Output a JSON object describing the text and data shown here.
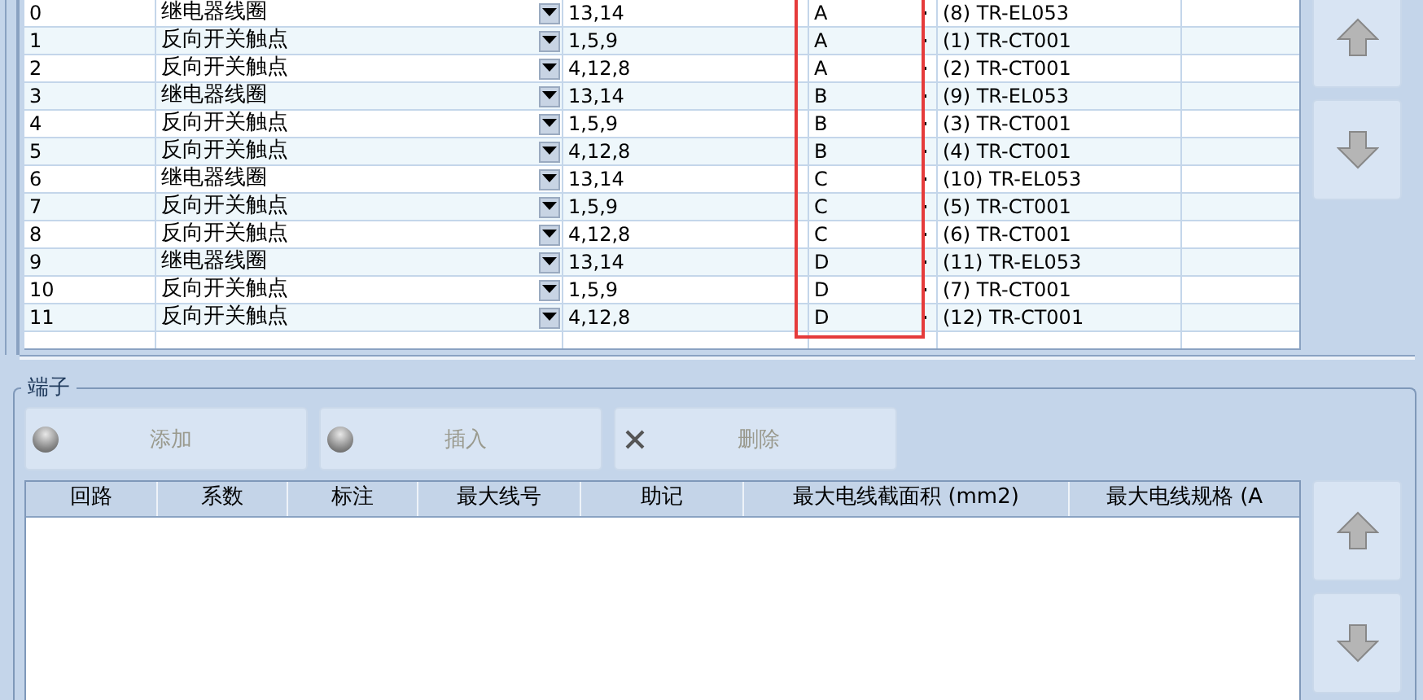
{
  "top_grid": {
    "rows": [
      {
        "column_1": "0",
        "column_2": "继电器线圈",
        "column_3": "13,14",
        "column_4": "A",
        "column_5": "(8) TR-EL053"
      },
      {
        "column_1": "1",
        "column_2": "反向开关触点",
        "column_3": "1,5,9",
        "column_4": "A",
        "column_5": "(1) TR-CT001"
      },
      {
        "column_1": "2",
        "column_2": "反向开关触点",
        "column_3": "4,12,8",
        "column_4": "A",
        "column_5": "(2) TR-CT001"
      },
      {
        "column_1": "3",
        "column_2": "继电器线圈",
        "column_3": "13,14",
        "column_4": "B",
        "column_5": "(9) TR-EL053"
      },
      {
        "column_1": "4",
        "column_2": "反向开关触点",
        "column_3": "1,5,9",
        "column_4": "B",
        "column_5": "(3) TR-CT001"
      },
      {
        "column_1": "5",
        "column_2": "反向开关触点",
        "column_3": "4,12,8",
        "column_4": "B",
        "column_5": "(4) TR-CT001"
      },
      {
        "column_1": "6",
        "column_2": "继电器线圈",
        "column_3": "13,14",
        "column_4": "C",
        "column_5": "(10) TR-EL053"
      },
      {
        "column_1": "7",
        "column_2": "反向开关触点",
        "column_3": "1,5,9",
        "column_4": "C",
        "column_5": "(5) TR-CT001"
      },
      {
        "column_1": "8",
        "column_2": "反向开关触点",
        "column_3": "4,12,8",
        "column_4": "C",
        "column_5": "(6) TR-CT001"
      },
      {
        "column_1": "9",
        "column_2": "继电器线圈",
        "column_3": "13,14",
        "column_4": "D",
        "column_5": "(11) TR-EL053"
      },
      {
        "column_1": "10",
        "column_2": "反向开关触点",
        "column_3": "1,5,9",
        "column_4": "D",
        "column_5": "(7) TR-CT001"
      },
      {
        "column_1": "11",
        "column_2": "反向开关触点",
        "column_3": "4,12,8",
        "column_4": "D",
        "column_5": "(12) TR-CT001"
      }
    ]
  },
  "terminals": {
    "title": "端子",
    "buttons": [
      {
        "label": "添加",
        "kind": "dot",
        "disabled": true
      },
      {
        "label": "插入",
        "kind": "dot",
        "disabled": true
      },
      {
        "label": "删除",
        "kind": "cross",
        "disabled": true
      }
    ],
    "columns": [
      "回路",
      "系数",
      "标注",
      "最大线号",
      "助记",
      "最大电线截面积 (mm2)",
      "最大电线规格 (A"
    ]
  }
}
